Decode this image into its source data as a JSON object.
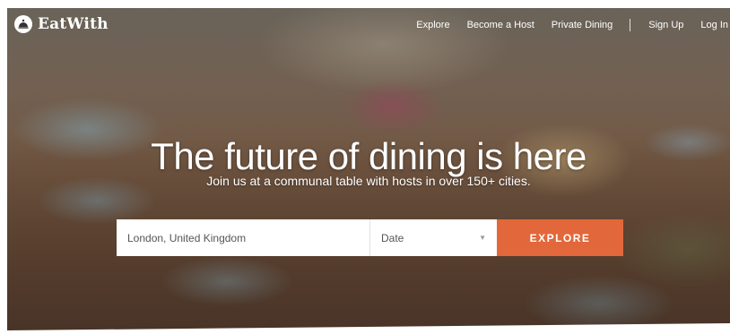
{
  "brand": {
    "name": "EatWith",
    "logo_icon": "cloche-icon"
  },
  "nav": {
    "items": [
      {
        "label": "Explore"
      },
      {
        "label": "Become a Host"
      },
      {
        "label": "Private Dining"
      },
      {
        "label": "Sign Up"
      },
      {
        "label": "Log In"
      }
    ]
  },
  "hero": {
    "headline": "The future of dining is here",
    "subheadline": "Join us at a communal table with hosts in over 150+ cities."
  },
  "search": {
    "location_value": "London, United Kingdom",
    "date_label": "Date",
    "date_icon": "chevron-down-icon",
    "button_label": "EXPLORE"
  },
  "colors": {
    "accent": "#e2673a",
    "text_on_hero": "#ffffff"
  }
}
